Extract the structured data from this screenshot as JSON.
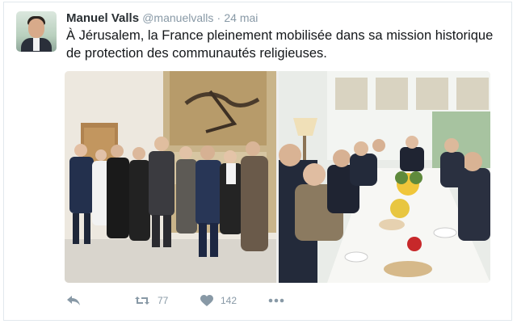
{
  "tweet": {
    "author_name": "Manuel Valls",
    "handle": "@manuelvalls",
    "separator": "·",
    "date": "24 mai",
    "text": "À Jérusalem, la France pleinement mobilisée dans sa mission historique de protection des communautés religieuses."
  },
  "media": {
    "photos": [
      {
        "subject": "group-portrait"
      },
      {
        "subject": "dinner-table-meeting"
      }
    ]
  },
  "actions": {
    "reply_icon": "reply-icon",
    "retweet_icon": "retweet-icon",
    "retweet_count": "77",
    "like_icon": "heart-icon",
    "like_count": "142",
    "more_icon": "more-dots-icon"
  },
  "colors": {
    "text_primary": "#14171a",
    "text_secondary": "#8899a6",
    "border": "#e1e8ed"
  }
}
